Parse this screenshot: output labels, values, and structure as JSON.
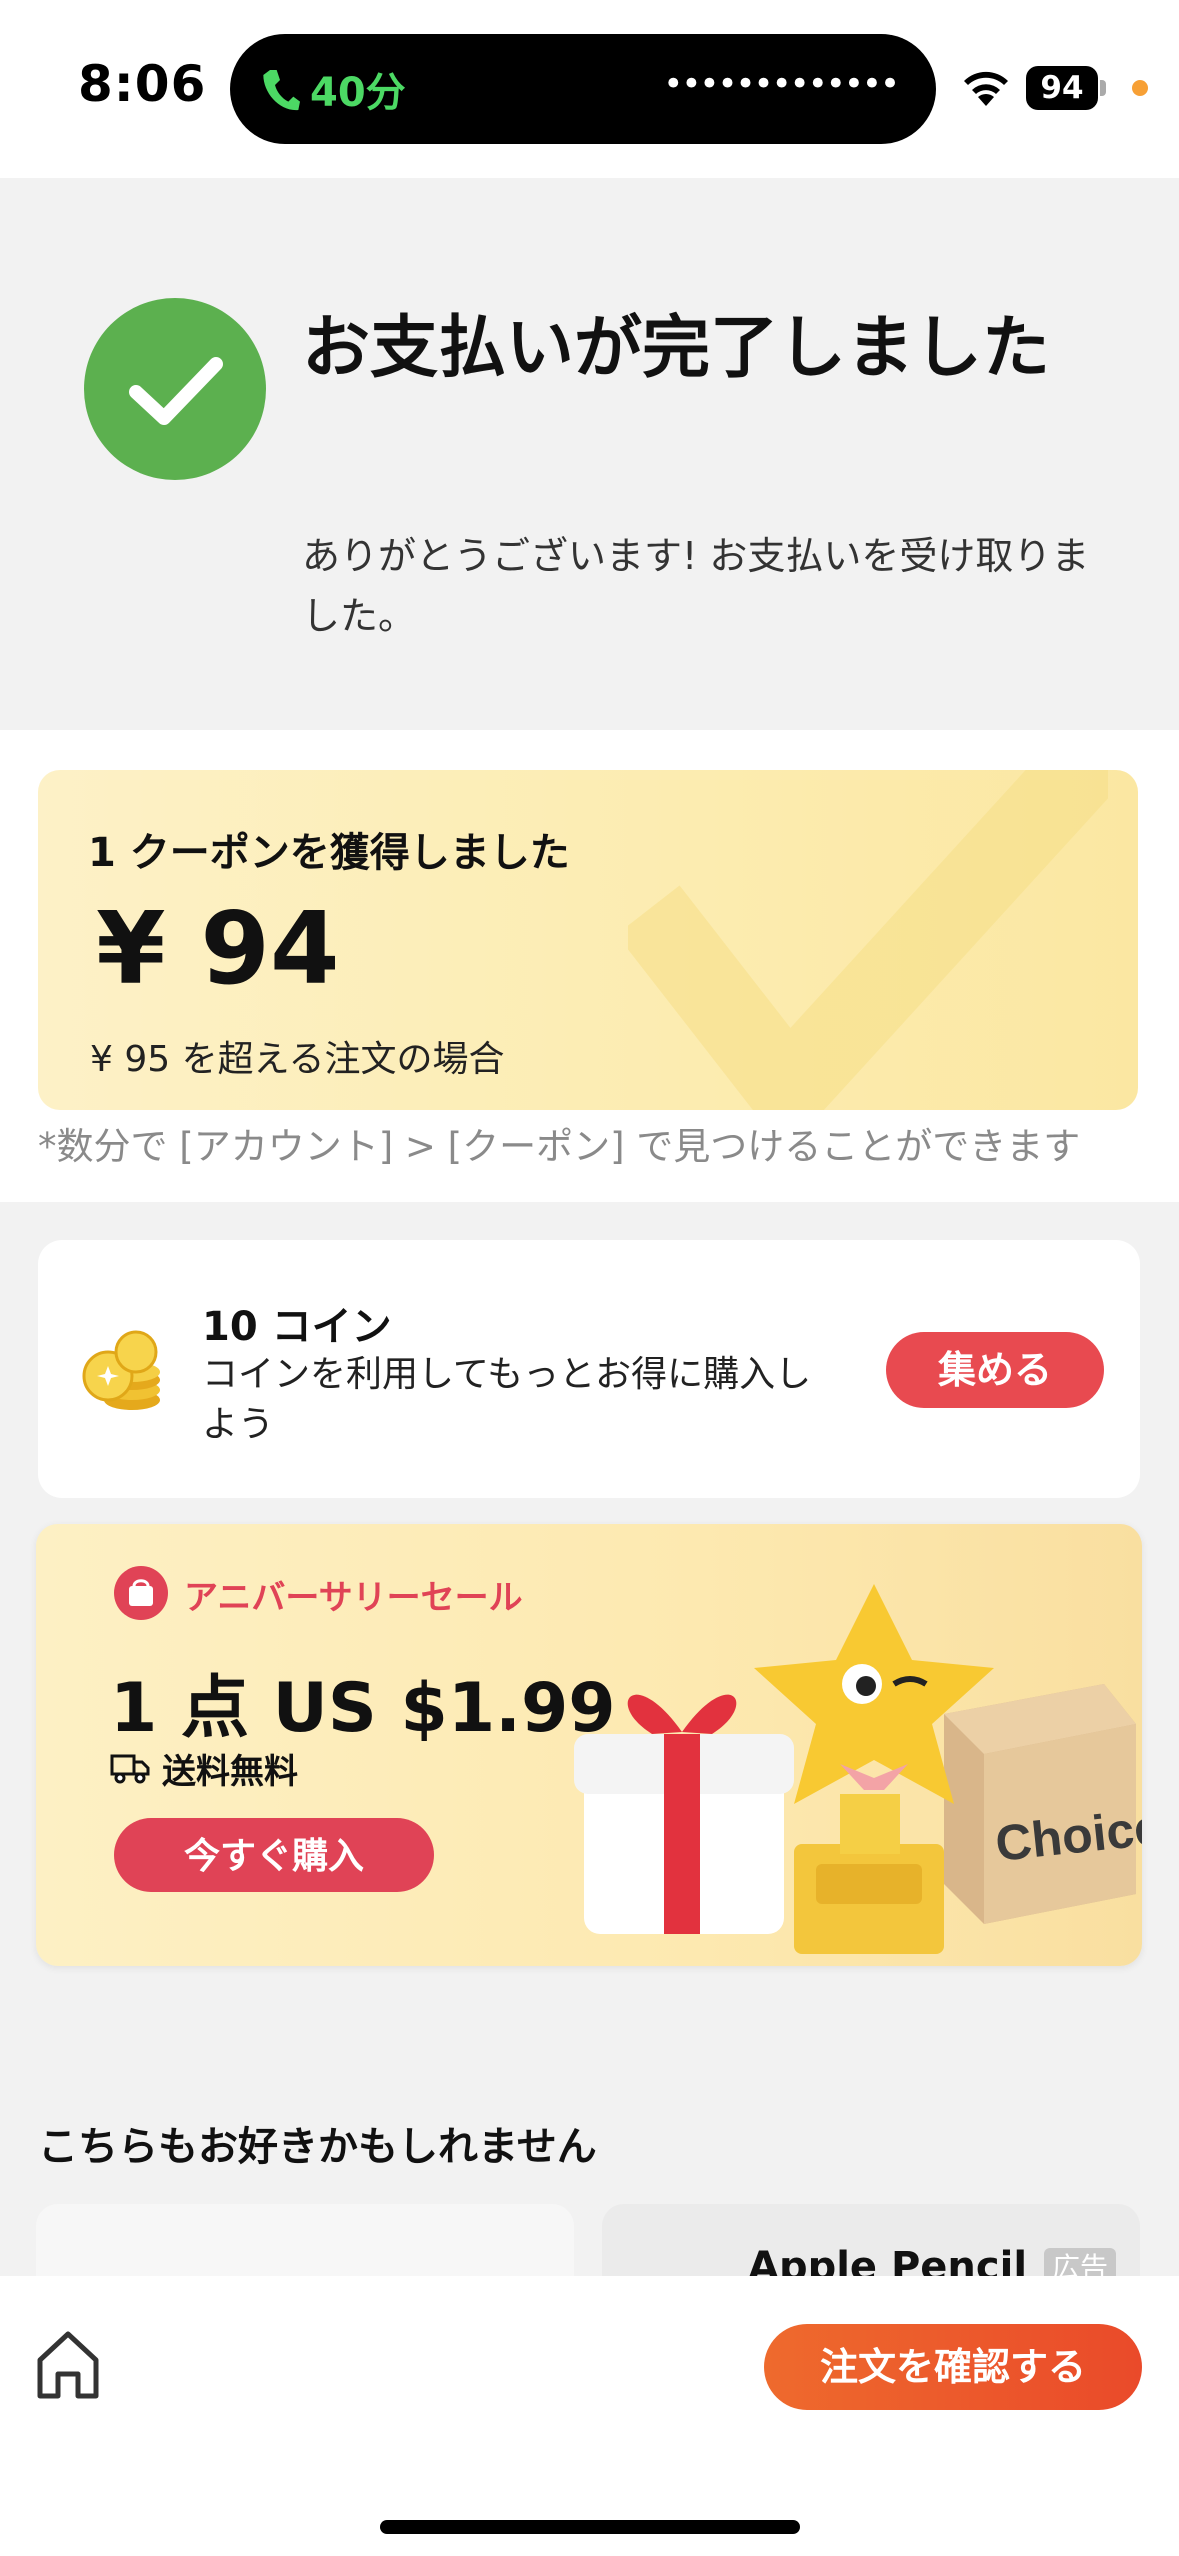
{
  "status_bar": {
    "time": "8:06",
    "call_duration": "40分",
    "battery": "94",
    "indicators": "wifi-icon, battery-icon, orange-privacy-dot"
  },
  "payment": {
    "title": "お支払いが完了しました",
    "subtitle": "ありがとうございます! お支払いを受け取りました。"
  },
  "coupon": {
    "label": "1 クーポンを獲得しました",
    "amount": "¥ 94",
    "condition": "¥ 95 を超える注文の場合",
    "note": "*数分で [アカウント] > [クーポン] で見つけることができます"
  },
  "coins": {
    "title": "10 コイン",
    "description": "コインを利用してもっとお得に購入しよう",
    "button": "集める"
  },
  "anniversary": {
    "label": "アニバーサリーセール",
    "price": "1 点 US $1.99",
    "shipping": "送料無料",
    "button": "今すぐ購入",
    "art_text": "Choice"
  },
  "recommendations": {
    "title": "こちらもお好きかもしれません",
    "items": [
      {
        "name": ""
      },
      {
        "name": "Apple Pencil",
        "badge": "広告"
      }
    ]
  },
  "bottom_bar": {
    "confirm_button": "注文を確認する"
  },
  "colors": {
    "success_green": "#5cb04f",
    "accent_red": "#e84a50",
    "confirm_orange": "#ee6a2d",
    "coupon_yellow": "#fcecb0"
  }
}
